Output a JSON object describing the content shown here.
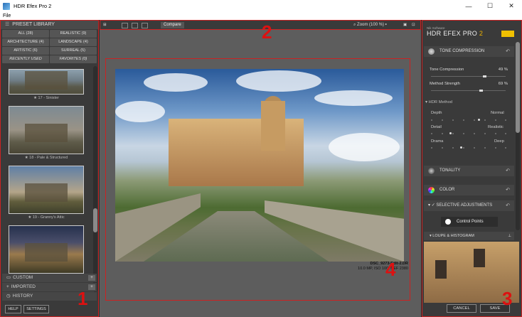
{
  "window": {
    "title": "HDR Efex Pro 2",
    "controls": [
      "—",
      "☐",
      "✕"
    ]
  },
  "menu": {
    "file": "File"
  },
  "left_panel": {
    "header": "PRESET LIBRARY",
    "categories": [
      "ALL (28)",
      "REALISTIC (9)",
      "ARCHITECTURE (4)",
      "LANDSCAPE (4)",
      "ARTISTIC (6)",
      "SURREAL (5)",
      "RECENTLY USED",
      "FAVORITES (0)"
    ],
    "presets": [
      {
        "label": "★ 17 - Sinister"
      },
      {
        "label": "★ 18 - Pale & Structured"
      },
      {
        "label": "★ 19 - Granny's Attic"
      },
      {
        "label": ""
      }
    ],
    "sections": [
      "CUSTOM",
      "IMPORTED",
      "HISTORY"
    ],
    "help": "HELP",
    "settings": "SETTINGS"
  },
  "toolbar": {
    "compare": "Compare",
    "zoom": "Zoom (100 %)"
  },
  "photo": {
    "filename": "DSC_9273-Edit-2.DR",
    "meta": "10.0 MP, ISO 100, NEF 2380"
  },
  "annotations": {
    "n1": "1",
    "n2": "2",
    "n3": "3",
    "n4": "4"
  },
  "right_panel": {
    "brand_small": "Nik Software",
    "brand_main": "HDR EFEX PRO ",
    "brand_num": "2",
    "tone_compression": "TONE COMPRESSION",
    "tone_compression_label": "Tone Compression",
    "tone_compression_value": "49 %",
    "method_strength_label": "Method Strength",
    "method_strength_value": "69 %",
    "hdr_method": "HDR Method",
    "depth": "Depth",
    "normal": "Normal",
    "detail": "Detail",
    "realistic": "Realistic",
    "drama": "Drama",
    "deep": "Deep",
    "tonality": "TONALITY",
    "color": "COLOR",
    "selective": "SELECTIVE ADJUSTMENTS",
    "control_points": "Control Points",
    "loupe": "LOUPE & HISTOGRAM",
    "cancel": "CANCEL",
    "save": "SAVE"
  }
}
